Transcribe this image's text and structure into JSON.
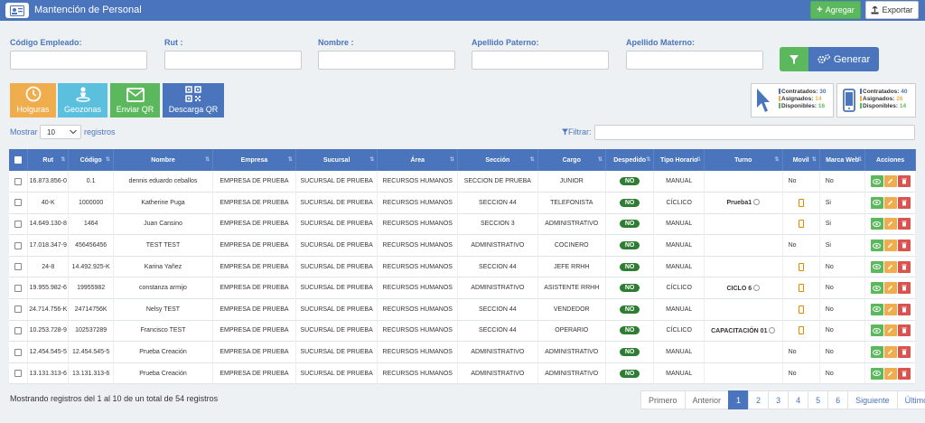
{
  "header": {
    "title": "Mantención de Personal",
    "add_label": "Agregar",
    "export_label": "Exportar"
  },
  "filters": {
    "codigo_label": "Código Empleado:",
    "rut_label": "Rut :",
    "nombre_label": "Nombre :",
    "apellido_paterno_label": "Apellido Paterno:",
    "apellido_materno_label": "Apellido Materno:",
    "generar_label": "Generar"
  },
  "tiles": [
    {
      "label": "Holguras",
      "color": "#f0ad4e",
      "icon": "clock-icon"
    },
    {
      "label": "Geozonas",
      "color": "#5bc0de",
      "icon": "person-pin-icon"
    },
    {
      "label": "Enviar QR",
      "color": "#5cb85c",
      "icon": "envelope-icon"
    },
    {
      "label": "Descarga QR",
      "color": "#4a75bd",
      "icon": "qr-icon"
    }
  ],
  "stats_desktop": {
    "contratados_label": "Contratados:",
    "contratados": "30",
    "asignados_label": "Asignados:",
    "asignados": "14",
    "disponibles_label": "Disponibles:",
    "disponibles": "16"
  },
  "stats_mobile": {
    "contratados_label": "Contratados:",
    "contratados": "40",
    "asignados_label": "Asignados:",
    "asignados": "26",
    "disponibles_label": "Disponibles:",
    "disponibles": "14"
  },
  "length": {
    "prefix": "Mostrar",
    "value": "10",
    "suffix": "registros"
  },
  "search": {
    "label": "Filtrar:"
  },
  "columns": [
    "Rut",
    "Código",
    "Nombre",
    "Empresa",
    "Sucursal",
    "Área",
    "Sección",
    "Cargo",
    "Despedido",
    "Tipo Horario",
    "Turno",
    "Movil",
    "Marca Web",
    "Acciones"
  ],
  "rows": [
    {
      "rut": "16.873.856-0",
      "codigo": "0.1",
      "nombre": "dennis eduardo ceballos",
      "empresa": "EMPRESA DE PRUEBA",
      "sucursal": "SUCURSAL DE PRUEBA",
      "area": "RECURSOS HUMANOS",
      "seccion": "SECCION DE PRUEBA",
      "cargo": "JUNIOR",
      "despedido": "NO",
      "tipo_horario": "MANUAL",
      "turno": "",
      "movil": "No",
      "marca_web": "No"
    },
    {
      "rut": "40-K",
      "codigo": "1000000",
      "nombre": "Katherine Puga",
      "empresa": "EMPRESA DE PRUEBA",
      "sucursal": "SUCURSAL DE PRUEBA",
      "area": "RECURSOS HUMANOS",
      "seccion": "SECCION 44",
      "cargo": "TELEFONISTA",
      "despedido": "NO",
      "tipo_horario": "CÍCLICO",
      "turno": "Prueba1",
      "movil": "phone",
      "marca_web": "Si"
    },
    {
      "rut": "14.649.130-8",
      "codigo": "1464",
      "nombre": "Juan Cansino",
      "empresa": "EMPRESA DE PRUEBA",
      "sucursal": "SUCURSAL DE PRUEBA",
      "area": "RECURSOS HUMANOS",
      "seccion": "SECCION 3",
      "cargo": "ADMINISTRATIVO",
      "despedido": "NO",
      "tipo_horario": "MANUAL",
      "turno": "",
      "movil": "phone",
      "marca_web": "Si"
    },
    {
      "rut": "17.018.347-9",
      "codigo": "456456456",
      "nombre": "TEST TEST",
      "empresa": "EMPRESA DE PRUEBA",
      "sucursal": "SUCURSAL DE PRUEBA",
      "area": "RECURSOS HUMANOS",
      "seccion": "ADMINISTRATIVO",
      "cargo": "COCINERO",
      "despedido": "NO",
      "tipo_horario": "MANUAL",
      "turno": "",
      "movil": "No",
      "marca_web": "Si"
    },
    {
      "rut": "24-8",
      "codigo": "14.492.925-K",
      "nombre": "Karina Yañez",
      "empresa": "EMPRESA DE PRUEBA",
      "sucursal": "SUCURSAL DE PRUEBA",
      "area": "RECURSOS HUMANOS",
      "seccion": "SECCION 44",
      "cargo": "JEFE RRHH",
      "despedido": "NO",
      "tipo_horario": "MANUAL",
      "turno": "",
      "movil": "phone",
      "marca_web": "No"
    },
    {
      "rut": "19.955.982-6",
      "codigo": "19955982",
      "nombre": "constanza armijo",
      "empresa": "EMPRESA DE PRUEBA",
      "sucursal": "SUCURSAL DE PRUEBA",
      "area": "RECURSOS HUMANOS",
      "seccion": "ADMINISTRATIVO",
      "cargo": "ASISTENTE RRHH",
      "despedido": "NO",
      "tipo_horario": "CÍCLICO",
      "turno": "CICLO 6",
      "movil": "phone",
      "marca_web": "No"
    },
    {
      "rut": "24.714.756-K",
      "codigo": "24714756K",
      "nombre": "Nelsy TEST",
      "empresa": "EMPRESA DE PRUEBA",
      "sucursal": "SUCURSAL DE PRUEBA",
      "area": "RECURSOS HUMANOS",
      "seccion": "SECCION 44",
      "cargo": "VENDEDOR",
      "despedido": "NO",
      "tipo_horario": "MANUAL",
      "turno": "",
      "movil": "phone",
      "marca_web": "No"
    },
    {
      "rut": "10.253.728-9",
      "codigo": "102537289",
      "nombre": "Francisco TEST",
      "empresa": "EMPRESA DE PRUEBA",
      "sucursal": "SUCURSAL DE PRUEBA",
      "area": "RECURSOS HUMANOS",
      "seccion": "SECCION 44",
      "cargo": "OPERARIO",
      "despedido": "NO",
      "tipo_horario": "CÍCLICO",
      "turno": "CAPACITACIÓN 01",
      "movil": "phone",
      "marca_web": "No"
    },
    {
      "rut": "12.454.545-5",
      "codigo": "12.454.545-5",
      "nombre": "Prueba Creación",
      "empresa": "EMPRESA DE PRUEBA",
      "sucursal": "SUCURSAL DE PRUEBA",
      "area": "RECURSOS HUMANOS",
      "seccion": "ADMINISTRATIVO",
      "cargo": "ADMINISTRATIVO",
      "despedido": "NO",
      "tipo_horario": "MANUAL",
      "turno": "",
      "movil": "No",
      "marca_web": "No"
    },
    {
      "rut": "13.131.313-6",
      "codigo": "13.131.313-6",
      "nombre": "Prueba Creación",
      "empresa": "EMPRESA DE PRUEBA",
      "sucursal": "SUCURSAL DE PRUEBA",
      "area": "RECURSOS HUMANOS",
      "seccion": "ADMINISTRATIVO",
      "cargo": "ADMINISTRATIVO",
      "despedido": "NO",
      "tipo_horario": "MANUAL",
      "turno": "",
      "movil": "No",
      "marca_web": "No"
    }
  ],
  "footer": {
    "info": "Mostrando registros del 1 al 10 de un total de 54 registros"
  },
  "pagination": {
    "first": "Primero",
    "prev": "Anterior",
    "pages": [
      "1",
      "2",
      "3",
      "4",
      "5",
      "6"
    ],
    "current": "1",
    "next": "Siguiente",
    "last": "Último"
  },
  "colors": {
    "primary": "#4a75bd",
    "success": "#5cb85c",
    "warning": "#f0ad4e",
    "info": "#5bc0de",
    "danger": "#d9534f",
    "badge_no": "#2e7d32"
  }
}
